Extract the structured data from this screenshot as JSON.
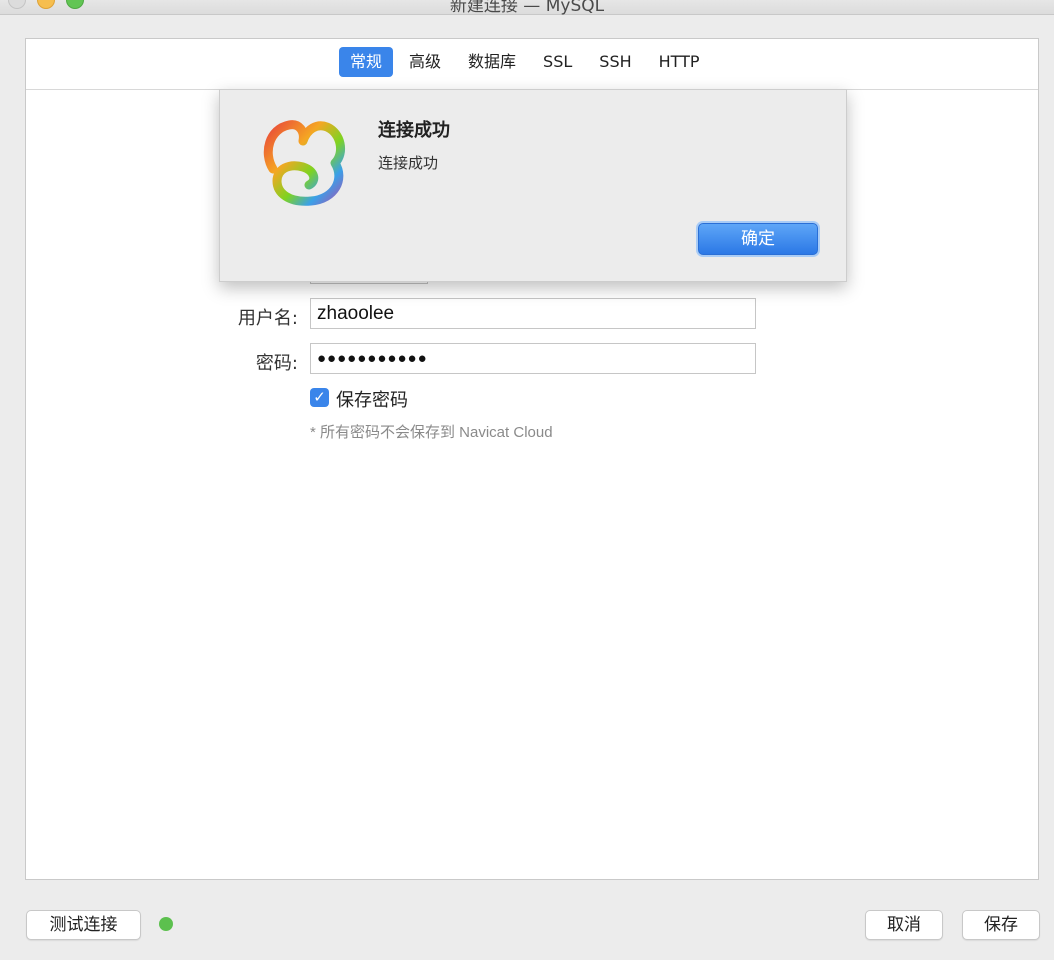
{
  "window": {
    "title": "新建连接 — MySQL"
  },
  "tabs": [
    {
      "label": "常规",
      "active": true
    },
    {
      "label": "高级",
      "active": false
    },
    {
      "label": "数据库",
      "active": false
    },
    {
      "label": "SSL",
      "active": false
    },
    {
      "label": "SSH",
      "active": false
    },
    {
      "label": "HTTP",
      "active": false
    }
  ],
  "form": {
    "username_label": "用户名:",
    "username_value": "zhaoolee",
    "password_label": "密码:",
    "password_value": "●●●●●●●●●●●",
    "save_password_label": "保存密码",
    "save_password_checked": true,
    "note": "* 所有密码不会保存到 Navicat Cloud"
  },
  "dialog": {
    "title": "连接成功",
    "message": "连接成功",
    "ok_label": "确定"
  },
  "footer": {
    "test_button": "测试连接",
    "status_color": "#5cc04e",
    "cancel_button": "取消",
    "save_button": "保存"
  },
  "colors": {
    "accent": "#3a85ea"
  }
}
